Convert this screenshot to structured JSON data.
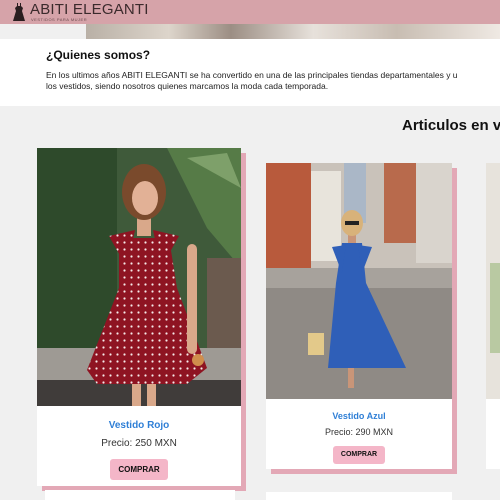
{
  "header": {
    "brand": "ABITI ELEGANTI",
    "tagline": "VESTIDOS PARA MUJER",
    "background_color": "#d6a3a9",
    "logo_icon": "dress-icon"
  },
  "about": {
    "title": "¿Quienes somos?",
    "line1": "En los ultimos años ABITI ELEGANTI se ha convertido en una de las principales tiendas departamentales y u",
    "line2": "los vestidos, siendo nosotros quienes marcamos la moda cada temporada."
  },
  "products_section": {
    "title": "Articulos en v"
  },
  "products": [
    {
      "name": "Vestido Rojo",
      "price": "Precio: 250 MXN",
      "button": "COMPRAR",
      "image": "red-polka-dot-dress-photo"
    },
    {
      "name": "Vestido Azul",
      "price": "Precio: 290 MXN",
      "button": "COMPRAR",
      "image": "blue-dress-street-photo"
    }
  ],
  "colors": {
    "accent_pink": "#f4b6c8",
    "card_shadow": "#e3a8b6",
    "link_blue": "#2f7fd6"
  }
}
